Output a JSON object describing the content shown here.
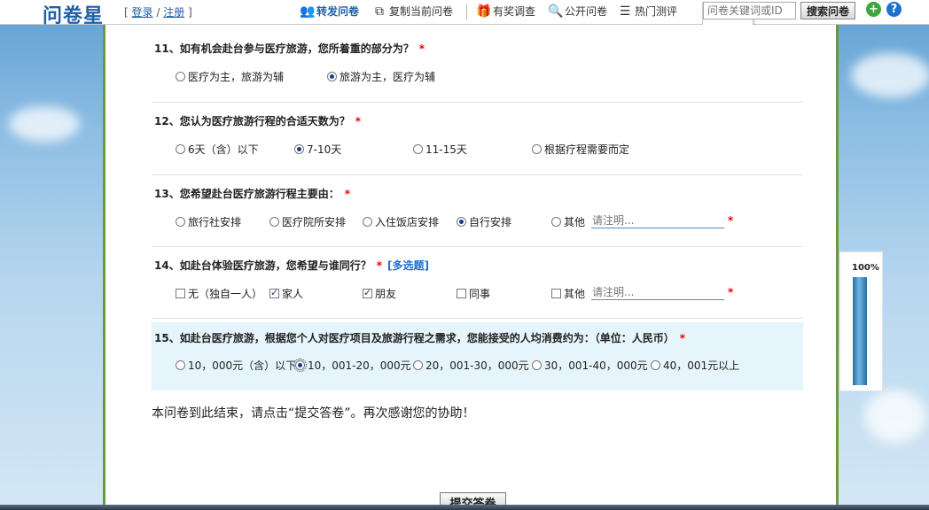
{
  "topbar": {
    "logo": "问卷星",
    "auth_open": "[",
    "login": "登录",
    "auth_sep": "/",
    "register": "注册",
    "auth_close": "]",
    "forward": "转发问卷",
    "copy": "复制当前问卷",
    "reward": "有奖调查",
    "public": "公开问卷",
    "hot": "热门测评",
    "search_placeholder": "问卷关键词或ID",
    "search_button": "搜索问卷"
  },
  "questions": [
    {
      "title": "11、如有机会赴台参与医疗旅游，您所着重的部分为？",
      "required_mark": "*",
      "options": [
        {
          "label": "医疗为主，旅游为辅",
          "checked": false
        },
        {
          "label": "旅游为主，医疗为辅",
          "checked": true
        }
      ]
    },
    {
      "title": "12、您认为医疗旅游行程的合适天数为？",
      "required_mark": "*",
      "options": [
        {
          "label": "6天（含）以下",
          "checked": false
        },
        {
          "label": "7-10天",
          "checked": true
        },
        {
          "label": "11-15天",
          "checked": false
        },
        {
          "label": "根据疗程需要而定",
          "checked": false
        }
      ]
    },
    {
      "title": "13、您希望赴台医疗旅游行程主要由：",
      "required_mark": "*",
      "options": [
        {
          "label": "旅行社安排",
          "checked": false
        },
        {
          "label": "医疗院所安排",
          "checked": false
        },
        {
          "label": "入住饭店安排",
          "checked": false
        },
        {
          "label": "自行安排",
          "checked": true
        },
        {
          "label": "其他",
          "checked": false
        }
      ],
      "other_placeholder": "请注明..."
    },
    {
      "title": "14、如赴台体验医疗旅游，您希望与谁同行？",
      "required_mark": "*",
      "multi_tag": "[多选题]",
      "options": [
        {
          "label": "无（独自一人）",
          "checked": false
        },
        {
          "label": "家人",
          "checked": true
        },
        {
          "label": "朋友",
          "checked": true
        },
        {
          "label": "同事",
          "checked": false
        },
        {
          "label": "其他",
          "checked": false
        }
      ],
      "other_placeholder": "请注明..."
    },
    {
      "title": "15、如赴台医疗旅游，根据您个人对医疗项目及旅游行程之需求，您能接受的人均消费约为：（单位：人民币）",
      "required_mark": "*",
      "options": [
        {
          "label": "10，000元（含）以下",
          "checked": false
        },
        {
          "label": "10，001-20，000元",
          "checked": true
        },
        {
          "label": "20，001-30，000元",
          "checked": false
        },
        {
          "label": "30，001-40，000元",
          "checked": false
        },
        {
          "label": "40，001元以上",
          "checked": false
        }
      ]
    }
  ],
  "ending_text": "本问卷到此结束，请点击“提交答卷”。再次感谢您的协助！",
  "submit_label": "提交答卷",
  "progress": {
    "label": "100%",
    "value": 100
  },
  "colors": {
    "brand": "#1f5fa8",
    "required": "#e00000",
    "highlight_bg": "#e6f5fb",
    "panel_border": "#6b9a3d"
  },
  "icons": [
    "forward-icon",
    "copy-icon",
    "gift-icon",
    "search-icon",
    "list-icon",
    "add-icon",
    "help-icon"
  ]
}
